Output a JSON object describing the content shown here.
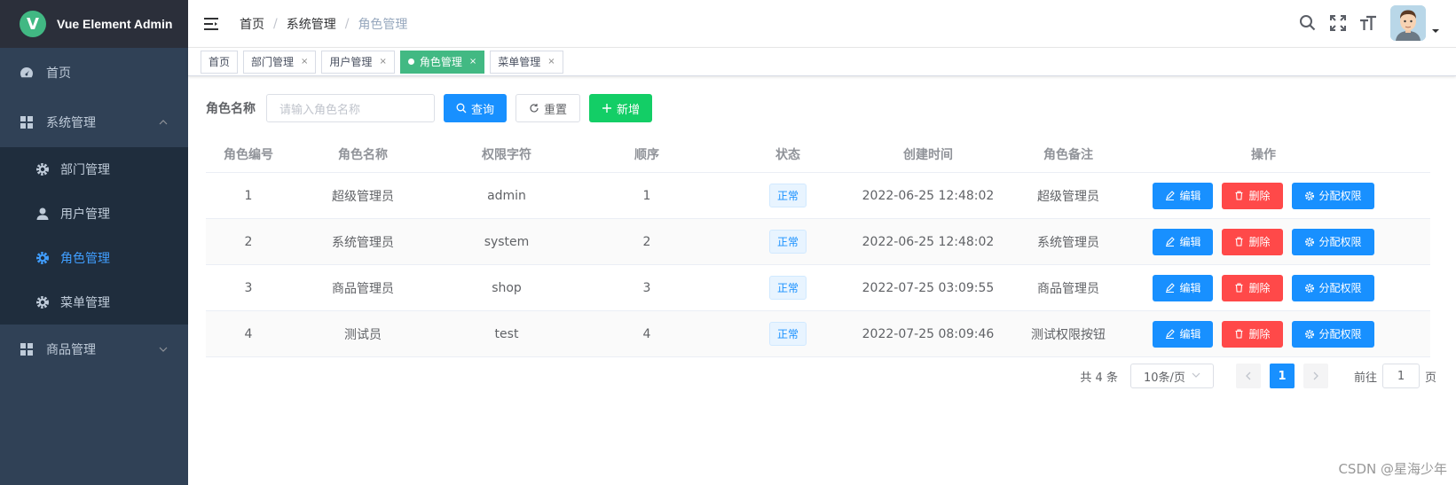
{
  "app": {
    "title": "Vue Element Admin",
    "logo_letter": "V"
  },
  "sidebar": {
    "items": [
      {
        "label": "首页",
        "icon": "dashboard-icon"
      },
      {
        "label": "系统管理",
        "icon": "grid-icon",
        "expanded": true
      },
      {
        "label": "部门管理",
        "icon": "gear-icon"
      },
      {
        "label": "用户管理",
        "icon": "user-icon"
      },
      {
        "label": "角色管理",
        "icon": "gear-icon",
        "active": true
      },
      {
        "label": "菜单管理",
        "icon": "gear-icon"
      },
      {
        "label": "商品管理",
        "icon": "grid-icon",
        "expanded": false
      }
    ]
  },
  "breadcrumb": [
    "首页",
    "系统管理",
    "角色管理"
  ],
  "tags": [
    {
      "label": "首页",
      "closable": false
    },
    {
      "label": "部门管理",
      "closable": true
    },
    {
      "label": "用户管理",
      "closable": true
    },
    {
      "label": "角色管理",
      "closable": true,
      "active": true
    },
    {
      "label": "菜单管理",
      "closable": true
    }
  ],
  "tag_close": "×",
  "search": {
    "label": "角色名称",
    "placeholder": "请输入角色名称",
    "query_label": "查询",
    "reset_label": "重置",
    "add_label": "新增"
  },
  "table": {
    "columns": [
      "角色编号",
      "角色名称",
      "权限字符",
      "顺序",
      "状态",
      "创建时间",
      "角色备注",
      "操作"
    ],
    "rows": [
      {
        "id": "1",
        "name": "超级管理员",
        "key": "admin",
        "sort": "1",
        "status": "正常",
        "created": "2022-06-25 12:48:02",
        "remark": "超级管理员"
      },
      {
        "id": "2",
        "name": "系统管理员",
        "key": "system",
        "sort": "2",
        "status": "正常",
        "created": "2022-06-25 12:48:02",
        "remark": "系统管理员"
      },
      {
        "id": "3",
        "name": "商品管理员",
        "key": "shop",
        "sort": "3",
        "status": "正常",
        "created": "2022-07-25 03:09:55",
        "remark": "商品管理员"
      },
      {
        "id": "4",
        "name": "测试员",
        "key": "test",
        "sort": "4",
        "status": "正常",
        "created": "2022-07-25 08:09:46",
        "remark": "测试权限按钮"
      }
    ],
    "actions": {
      "edit": "编辑",
      "delete": "删除",
      "assign": "分配权限"
    }
  },
  "pagination": {
    "total_text": "共 4 条",
    "page_size": "10条/页",
    "current_page": "1",
    "goto_label": "前往",
    "goto_value": "1",
    "page_suffix": "页"
  },
  "watermark": "CSDN @星海少年",
  "colors": {
    "primary": "#1890ff",
    "success": "#13ce66",
    "danger": "#ff4949",
    "sidebar": "#304156",
    "tag_active": "#42b983"
  }
}
